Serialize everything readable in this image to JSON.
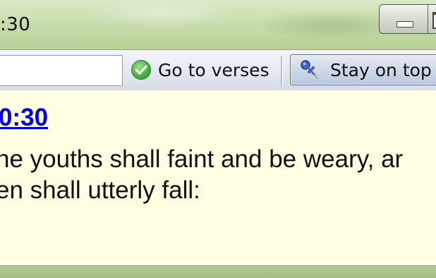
{
  "window": {
    "title": ":30"
  },
  "toolbar": {
    "search": {
      "value": "",
      "placeholder": ""
    },
    "go_button": {
      "label": "Go to verses",
      "icon": "check-circle-icon"
    },
    "stay_button": {
      "label": "Stay on top",
      "icon": "pin-icon",
      "active": true
    }
  },
  "content": {
    "reference": "0:30",
    "verse_lines": [
      "he youths shall faint and be weary, ar",
      "en shall utterly fall:"
    ]
  },
  "colors": {
    "link": "#0000ee",
    "content_bg": "#fffee2",
    "frame": "#b7cf96"
  }
}
